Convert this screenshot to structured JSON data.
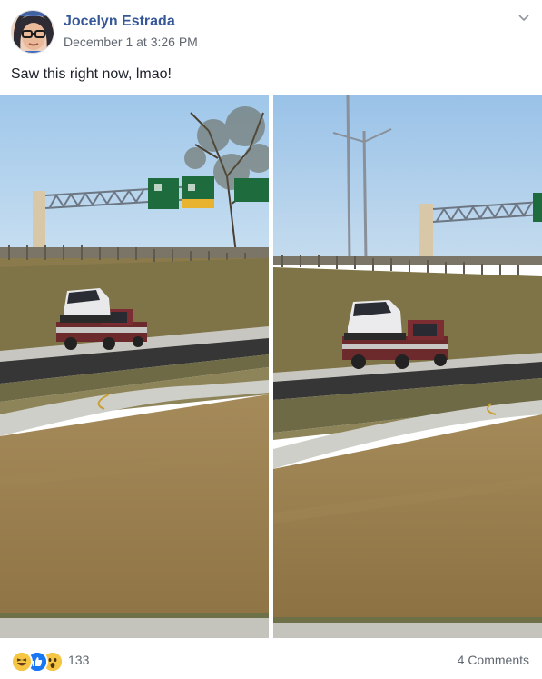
{
  "post": {
    "author": "Jocelyn Estrada",
    "timestamp": "December 1 at 3:26 PM",
    "text": "Saw this right now, lmao!",
    "photos": [
      {
        "alt": "Pickup truck carrying a small white car on a highway frontage road"
      },
      {
        "alt": "Pickup truck carrying a small white car, second view"
      }
    ],
    "reactions": {
      "types": [
        "haha-icon",
        "like-icon",
        "wow-icon"
      ],
      "count": "133"
    },
    "comments_label": "4 Comments"
  },
  "colors": {
    "author_link": "#365899",
    "secondary_text": "#606770",
    "like_blue": "#1877f2",
    "reaction_yellow": "#f7c544"
  }
}
